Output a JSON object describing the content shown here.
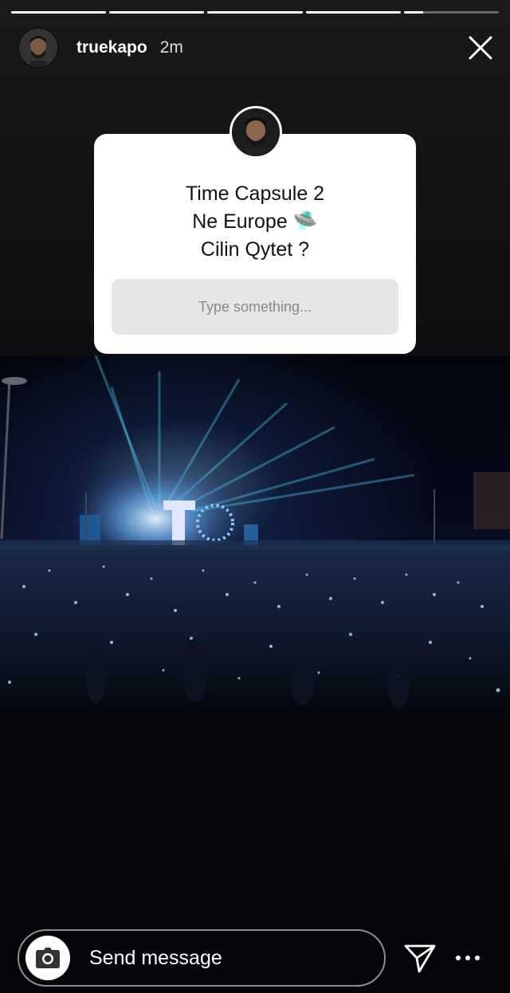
{
  "story": {
    "segments_progress": [
      1,
      1,
      1,
      1,
      0.2
    ]
  },
  "header": {
    "username": "truekapo",
    "time_ago": "2m"
  },
  "question_sticker": {
    "lines": [
      "Time Capsule 2",
      "Ne Europe 🛸",
      "Cilin Qytet ?"
    ],
    "placeholder": "Type something..."
  },
  "reply_bar": {
    "message_placeholder": "Send message"
  },
  "icons": {
    "close": "close-icon",
    "camera": "camera-icon",
    "send": "send-icon",
    "more": "more-options-icon"
  }
}
